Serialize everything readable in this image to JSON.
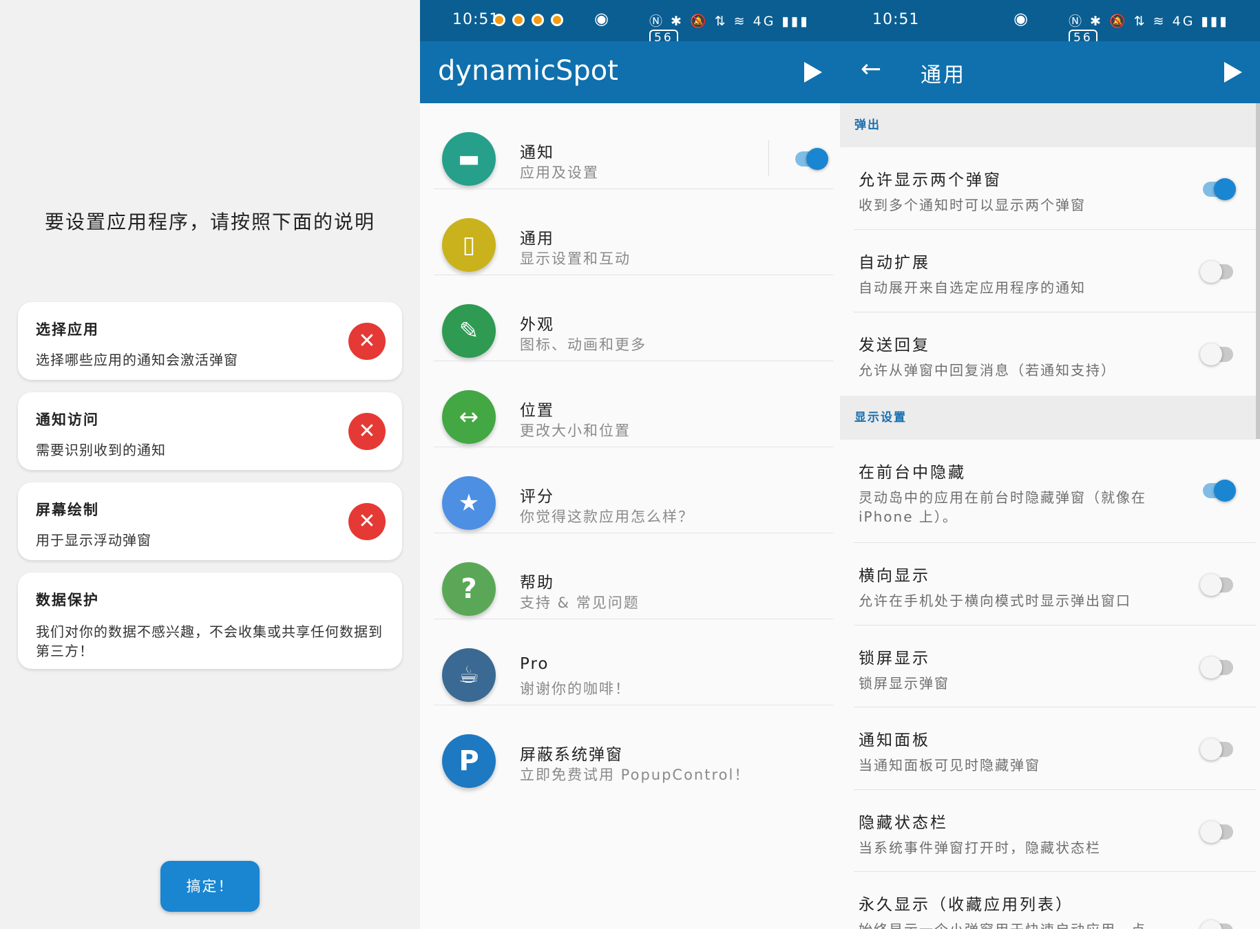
{
  "onboarding": {
    "heading": "要设置应用程序，请按照下面的说明",
    "cards": [
      {
        "title": "选择应用",
        "desc": "选择哪些应用的通知会激活弹窗",
        "status_icon": "close-icon"
      },
      {
        "title": "通知访问",
        "desc": "需要识别收到的通知",
        "status_icon": "close-icon"
      },
      {
        "title": "屏幕绘制",
        "desc": "用于显示浮动弹窗",
        "status_icon": "close-icon"
      },
      {
        "title": "数据保护",
        "desc": "我们对你的数据不感兴趣，不会收集或共享任何数据到第三方！"
      }
    ],
    "got_it": "搞定！",
    "status_color": "#e53935",
    "button_color": "#1a86d1"
  },
  "status_bar": {
    "time_main": "10:51",
    "time_settings": "10:51",
    "battery": "56",
    "network_icons": "Ⓝ ✱ 🔕 ⇅ ≋ 4G ▮▮▮",
    "eye_glyph": "◉"
  },
  "main_screen": {
    "app_title": "dynamicSpot",
    "items": [
      {
        "title": "通知",
        "subtitle": "应用及设置",
        "icon": "chat-bubble-icon",
        "glyph": "▬",
        "color": "#26a08b",
        "toggle": true
      },
      {
        "title": "通用",
        "subtitle": "显示设置和互动",
        "icon": "phone-icon",
        "glyph": "▯",
        "color": "#c9b21c"
      },
      {
        "title": "外观",
        "subtitle": "图标、动画和更多",
        "icon": "brush-icon",
        "glyph": "✎",
        "color": "#2e9a52"
      },
      {
        "title": "位置",
        "subtitle": "更改大小和位置",
        "icon": "resize-icon",
        "glyph": "↔",
        "color": "#43a843"
      },
      {
        "title": "评分",
        "subtitle": "你觉得这款应用怎么样？",
        "icon": "star-icon",
        "glyph": "★",
        "color": "#4d8fe3"
      },
      {
        "title": "帮助",
        "subtitle": "支持 & 常见问题",
        "icon": "help-icon",
        "glyph": "?",
        "color": "#5aa857"
      },
      {
        "title": "Pro",
        "subtitle": "谢谢你的咖啡！",
        "icon": "coffee-icon",
        "glyph": "☕",
        "color": "#3a6a93"
      },
      {
        "title": "屏蔽系统弹窗",
        "subtitle": "立即免费试用 PopupControl！",
        "icon": "popupcontrol-logo-icon",
        "glyph": "P",
        "color": "#1d79c2"
      }
    ]
  },
  "general_screen": {
    "title": "通用",
    "sections": [
      {
        "label": "弹出",
        "items": [
          {
            "title": "允许显示两个弹窗",
            "desc": "收到多个通知时可以显示两个弹窗",
            "on": true
          },
          {
            "title": "自动扩展",
            "desc": "自动展开来自选定应用程序的通知",
            "on": false
          },
          {
            "title": "发送回复",
            "desc": "允许从弹窗中回复消息（若通知支持）",
            "on": false
          }
        ]
      },
      {
        "label": "显示设置",
        "items": [
          {
            "title": "在前台中隐藏",
            "desc": "灵动岛中的应用在前台时隐藏弹窗（就像在 iPhone 上）。",
            "on": true
          },
          {
            "title": "横向显示",
            "desc": "允许在手机处于横向模式时显示弹出窗口",
            "on": false
          },
          {
            "title": "锁屏显示",
            "desc": "锁屏显示弹窗",
            "on": false
          },
          {
            "title": "通知面板",
            "desc": "当通知面板可见时隐藏弹窗",
            "on": false
          },
          {
            "title": "隐藏状态栏",
            "desc": "当系统事件弹窗打开时，隐藏状态栏",
            "on": false
          },
          {
            "title": "永久显示（收藏应用列表）",
            "desc": "始终显示一个小弹窗用于快速启动应用，点",
            "on": false
          }
        ]
      }
    ],
    "accent": "#1a86d1"
  }
}
